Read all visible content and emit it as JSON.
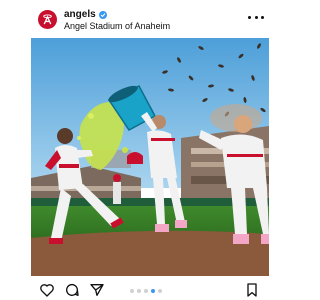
{
  "post": {
    "username": "angels",
    "verified": true,
    "location": "Angel Stadium of Anaheim",
    "image_alt": "Angels players celebrating with a Gatorade bucket shower and sunflower seeds on the field"
  },
  "icons": {
    "avatar": "angels-halo-logo",
    "more": "more-options-icon",
    "like": "heart-icon",
    "comment": "comment-icon",
    "share": "send-icon",
    "save": "bookmark-icon"
  },
  "carousel": {
    "count": 5,
    "active_index": 3
  },
  "colors": {
    "brand": "#c8102e",
    "verified": "#3897f0",
    "active_dot": "#3897f0"
  }
}
